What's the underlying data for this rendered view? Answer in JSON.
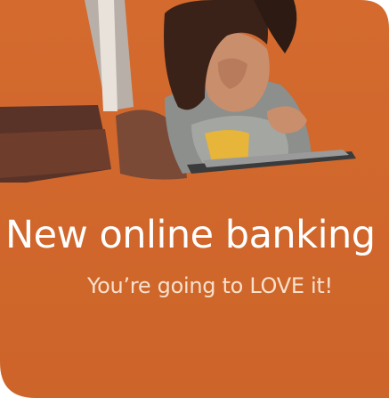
{
  "banner": {
    "headline": "New online banking",
    "subline": "You’re going to LOVE it!",
    "photo": "woman-with-laptop-photo"
  },
  "colors": {
    "brand_orange": "#d2682c",
    "headline_text": "#ffffff",
    "subline_text": "#f8e1cc",
    "background": "#ffffff"
  }
}
